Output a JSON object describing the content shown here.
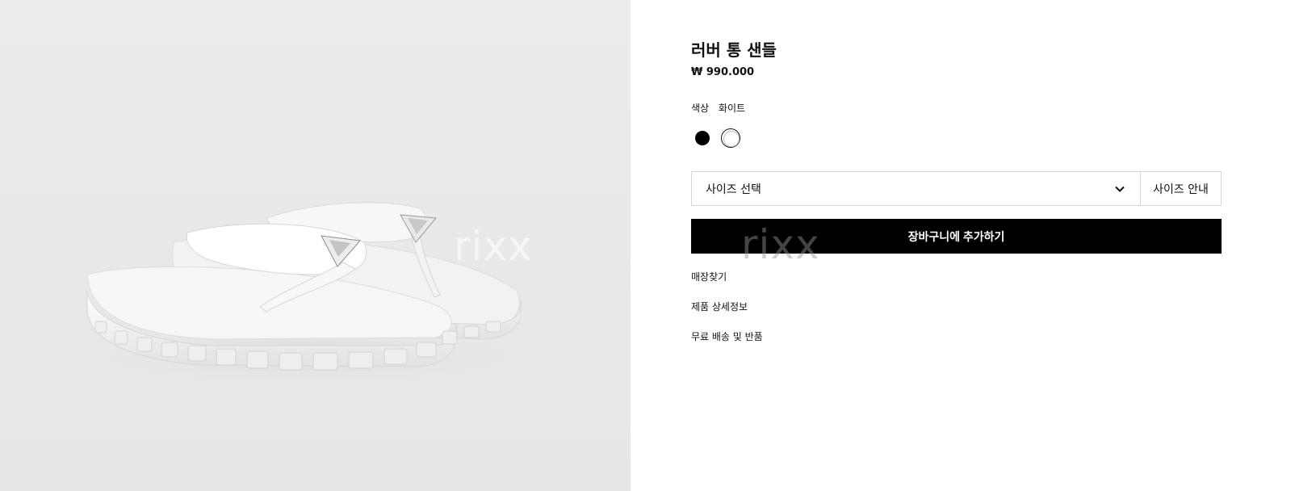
{
  "product": {
    "title": "러버 통 샌들",
    "price": "₩ 990.000",
    "color_label": "색상",
    "color_value": "화이트",
    "swatches": [
      {
        "name": "black",
        "hex": "#000000",
        "selected": false
      },
      {
        "name": "white",
        "hex": "#ffffff",
        "selected": true
      }
    ]
  },
  "size": {
    "select_label": "사이즈 선택",
    "guide_label": "사이즈 안내"
  },
  "cart": {
    "button_label": "장바구니에 추가하기"
  },
  "links": {
    "store_finder": "매장찾기",
    "product_details": "제품 상세정보",
    "shipping_returns": "무료 배송 및 반품"
  },
  "watermark": {
    "text": "rixx"
  },
  "colors": {
    "button_bg": "#000000",
    "gallery_bg": "#ebebeb"
  }
}
